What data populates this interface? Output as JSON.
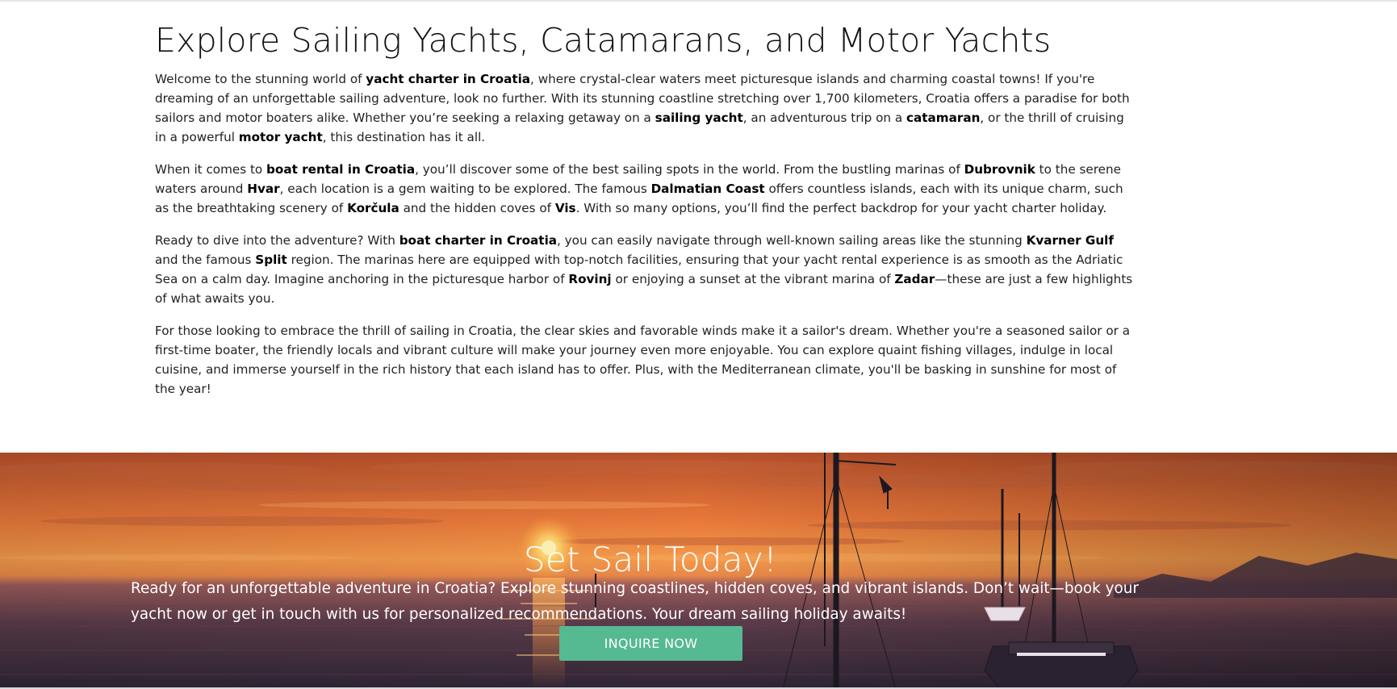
{
  "article": {
    "title": "Explore Sailing Yachts, Catamarans, and Motor Yachts",
    "paragraphs": [
      {
        "segments": [
          {
            "text": "Welcome to the stunning world of ",
            "bold": false
          },
          {
            "text": "yacht charter in Croatia",
            "bold": true
          },
          {
            "text": ", where crystal-clear waters meet picturesque islands and charming coastal towns! If you're dreaming of an unforgettable sailing adventure, look no further. With its stunning coastline stretching over 1,700 kilometers, Croatia offers a paradise for both sailors and motor boaters alike. Whether you’re seeking a relaxing getaway on a ",
            "bold": false
          },
          {
            "text": "sailing yacht",
            "bold": true
          },
          {
            "text": ", an adventurous trip on a ",
            "bold": false
          },
          {
            "text": "catamaran",
            "bold": true
          },
          {
            "text": ", or the thrill of cruising in a powerful ",
            "bold": false
          },
          {
            "text": "motor yacht",
            "bold": true
          },
          {
            "text": ", this destination has it all.",
            "bold": false
          }
        ]
      },
      {
        "segments": [
          {
            "text": "When it comes to ",
            "bold": false
          },
          {
            "text": "boat rental in Croatia",
            "bold": true
          },
          {
            "text": ", you’ll discover some of the best sailing spots in the world. From the bustling marinas of ",
            "bold": false
          },
          {
            "text": "Dubrovnik",
            "bold": true
          },
          {
            "text": " to the serene waters around ",
            "bold": false
          },
          {
            "text": "Hvar",
            "bold": true
          },
          {
            "text": ", each location is a gem waiting to be explored. The famous ",
            "bold": false
          },
          {
            "text": "Dalmatian Coast",
            "bold": true
          },
          {
            "text": " offers countless islands, each with its unique charm, such as the breathtaking scenery of ",
            "bold": false
          },
          {
            "text": "Korčula",
            "bold": true
          },
          {
            "text": " and the hidden coves of ",
            "bold": false
          },
          {
            "text": "Vis",
            "bold": true
          },
          {
            "text": ". With so many options, you’ll find the perfect backdrop for your yacht charter holiday.",
            "bold": false
          }
        ]
      },
      {
        "segments": [
          {
            "text": "Ready to dive into the adventure? With ",
            "bold": false
          },
          {
            "text": "boat charter in Croatia",
            "bold": true
          },
          {
            "text": ", you can easily navigate through well-known sailing areas like the stunning ",
            "bold": false
          },
          {
            "text": "Kvarner Gulf",
            "bold": true
          },
          {
            "text": " and the famous ",
            "bold": false
          },
          {
            "text": "Split",
            "bold": true
          },
          {
            "text": " region. The marinas here are equipped with top-notch facilities, ensuring that your yacht rental experience is as smooth as the Adriatic Sea on a calm day. Imagine anchoring in the picturesque harbor of ",
            "bold": false
          },
          {
            "text": "Rovinj",
            "bold": true
          },
          {
            "text": " or enjoying a sunset at the vibrant marina of ",
            "bold": false
          },
          {
            "text": "Zadar",
            "bold": true
          },
          {
            "text": "—these are just a few highlights of what awaits you.",
            "bold": false
          }
        ]
      },
      {
        "segments": [
          {
            "text": "For those looking to embrace the thrill of sailing in Croatia, the clear skies and favorable winds make it a sailor's dream. Whether you're a seasoned sailor or a first-time boater, the friendly locals and vibrant culture will make your journey even more enjoyable. You can explore quaint fishing villages, indulge in local cuisine, and immerse yourself in the rich history that each island has to offer. Plus, with the Mediterranean climate, you'll be basking in sunshine for most of the year!",
            "bold": false
          }
        ]
      }
    ]
  },
  "cta": {
    "title": "Set Sail Today!",
    "text": "Ready for an unforgettable adventure in Croatia? Explore stunning coastlines, hidden coves, and vibrant islands. Don’t wait—book your yacht now or get in touch with us for personalized recommendations. Your dream sailing holiday awaits!",
    "button_label": "INQUIRE NOW",
    "colors": {
      "button": "#55b991",
      "sky_top": "#c85a2a",
      "sky_mid": "#f08a3a",
      "sea": "#3a2b3a"
    }
  }
}
